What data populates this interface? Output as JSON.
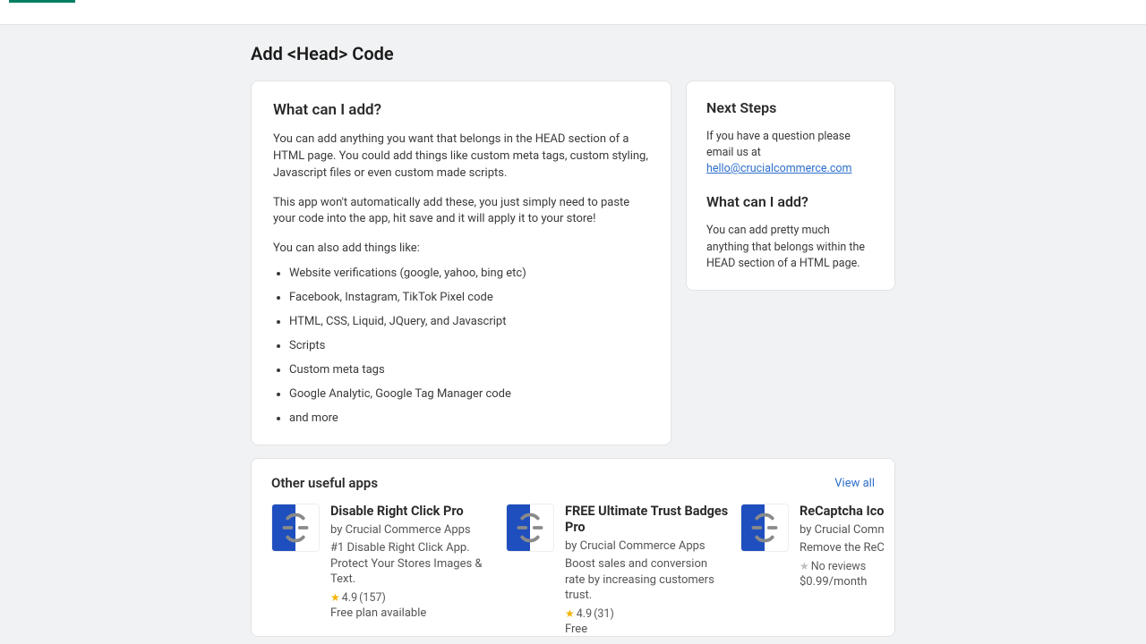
{
  "page": {
    "title": "Add <Head> Code"
  },
  "main": {
    "heading": "What can I add?",
    "p1": "You can add anything you want that belongs in the HEAD section of a HTML page. You could add things like custom meta tags, custom styling, Javascript files or even custom made scripts.",
    "p2": "This app won't automatically add these, you just simply need to paste your code into the app, hit save and it will apply it to your store!",
    "p3": "You can also add things like:",
    "bullets": [
      "Website verifications (google, yahoo, bing etc)",
      "Facebook, Instagram, TikTok Pixel code",
      "HTML, CSS, Liquid, JQuery, and Javascript",
      "Scripts",
      "Custom meta tags",
      "Google Analytic, Google Tag Manager code",
      "and more"
    ]
  },
  "side": {
    "heading1": "Next Steps",
    "q_intro": "If you have a question please email us at ",
    "email": "hello@crucialcommerce.com",
    "heading2": "What can I add?",
    "body2": "You can add pretty much anything that belongs within the HEAD section of a HTML page."
  },
  "recs": {
    "heading": "Other useful apps",
    "view_all": "View all",
    "apps": [
      {
        "name": "Disable Right Click Pro",
        "by": "by Crucial Commerce Apps",
        "desc": "#1 Disable Right Click App. Protect Your Stores Images & Text.",
        "rating": "4.9",
        "count": "(157)",
        "price": "Free plan available",
        "has_reviews": true
      },
      {
        "name": "FREE Ultimate Trust Badges Pro",
        "by": "by Crucial Commerce Apps",
        "desc": "Boost sales and conversion rate by increasing customers trust.",
        "rating": "4.9",
        "count": "(31)",
        "price": "Free",
        "has_reviews": true
      },
      {
        "name": "ReCaptcha Icon",
        "by": "by Crucial Commerce Apps",
        "desc": "Remove the ReCaptcha from the Bottom of Site",
        "no_reviews": "No reviews",
        "price": "$0.99/month",
        "has_reviews": false
      }
    ]
  }
}
